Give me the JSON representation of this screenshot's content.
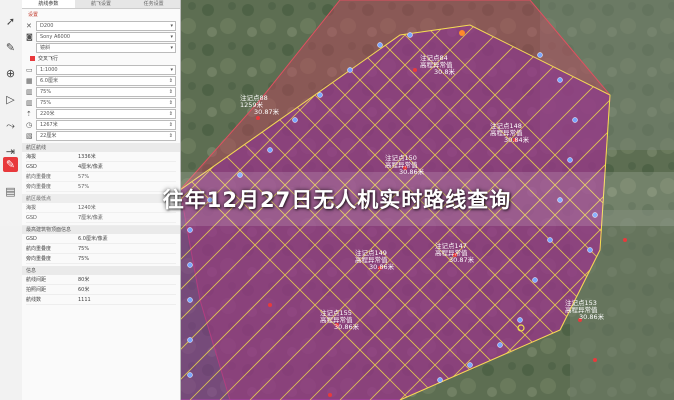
{
  "banner": {
    "title": "往年12月27日无人机实时路线查询"
  },
  "panel": {
    "tabs": [
      "航线参数",
      "航飞设置",
      "任务设置"
    ],
    "section_camera": "设置",
    "drone_model": "D200",
    "camera_model": "Sony A6000",
    "lens": "镜斜",
    "cross_flight_label": "交叉飞行",
    "scale": "1:1000",
    "gsd_input": "6.0厘米",
    "overlap_forward": "75%",
    "overlap_side": "75%",
    "altitude": "220米",
    "area_value": "1267米",
    "speed_value": "22厘米",
    "group1": "航区航线",
    "stats1": [
      {
        "k": "海拔",
        "v": "1336米"
      },
      {
        "k": "GSD",
        "v": "4厘米/像素"
      },
      {
        "k": "航向重叠度",
        "v": "57%"
      },
      {
        "k": "旁向重叠度",
        "v": "57%"
      }
    ],
    "group2": "航区最低点",
    "stats2": [
      {
        "k": "海拔",
        "v": "1240米"
      },
      {
        "k": "GSD",
        "v": "7厘米/像素"
      }
    ],
    "group3": "最高建筑物顶面信息",
    "stats3": [
      {
        "k": "GSD",
        "v": "6.0厘米/像素"
      },
      {
        "k": "航向重叠度",
        "v": "75%"
      },
      {
        "k": "旁向重叠度",
        "v": "75%"
      }
    ],
    "group4": "信息",
    "stats4": [
      {
        "k": "航线间距",
        "v": "80米"
      },
      {
        "k": "拍照间距",
        "v": "60米"
      },
      {
        "k": "航线数",
        "v": "1111"
      }
    ]
  },
  "map_labels": [
    {
      "t1": "注记点84",
      "t2": "高程异常值",
      "t3": "30.8米"
    },
    {
      "t1": "注记点88",
      "t2": "1259米",
      "t3": "30.87米"
    },
    {
      "t1": "注记点150",
      "t2": "高程异常值",
      "t3": "30.86米"
    },
    {
      "t1": "注记点148",
      "t2": "高程异常值",
      "t3": "30.84米"
    },
    {
      "t1": "注记点149",
      "t2": "高程异常值",
      "t3": "30.86米"
    },
    {
      "t1": "注记点147",
      "t2": "高程异常值",
      "t3": "30.87米"
    },
    {
      "t1": "注记点155",
      "t2": "高程异常值",
      "t3": "30.86米"
    },
    {
      "t1": "注记点153",
      "t2": "高程异常值",
      "t3": "30.86米"
    }
  ],
  "colors": {
    "accent": "#e8393c",
    "route": "#f2e14a",
    "area_fill": "#9b2fa0"
  }
}
